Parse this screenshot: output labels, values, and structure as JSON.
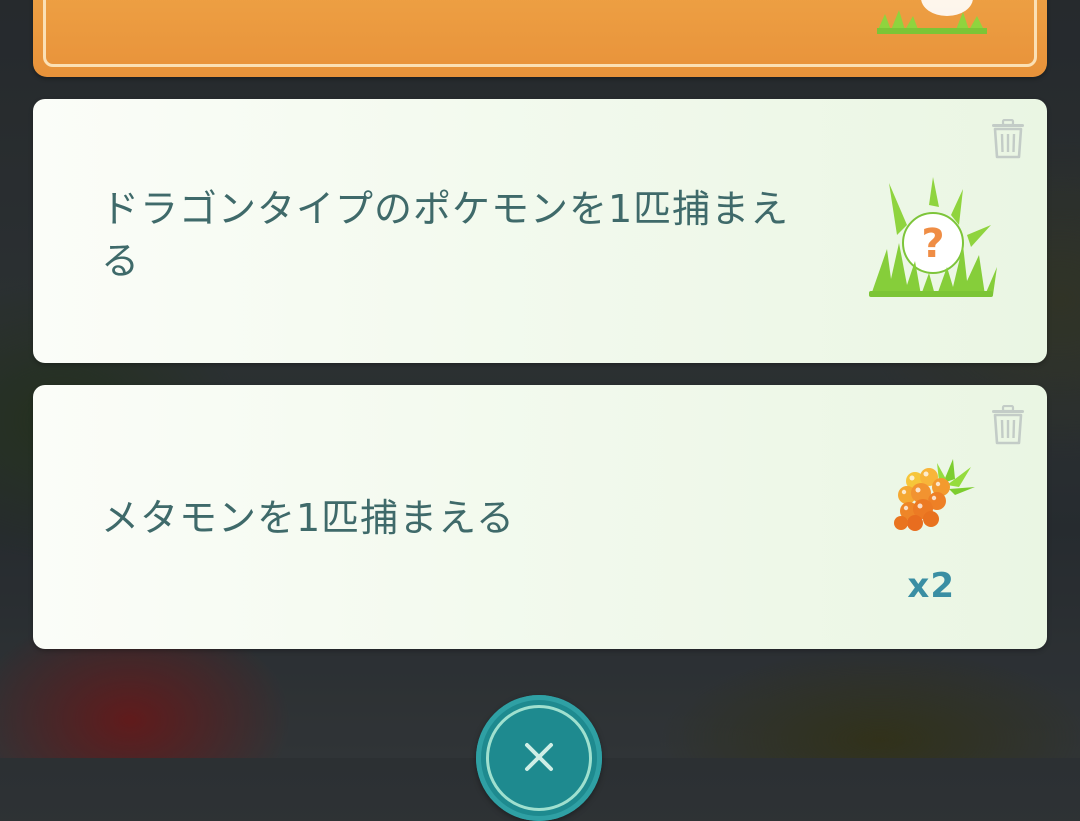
{
  "quests": [
    {
      "text": "ドラゴンタイプのポケモンを1匹捕まえる",
      "reward": {
        "type": "pokemon-encounter",
        "icon": "mystery-pokemon-encounter-icon"
      }
    },
    {
      "text": "メタモンを1匹捕まえる",
      "reward": {
        "type": "item",
        "icon": "golden-razz-berry-icon",
        "count": "x2"
      }
    }
  ],
  "icons": {
    "trash": "trash-icon",
    "close": "close-icon"
  },
  "colors": {
    "quest_text": "#3f6a6a",
    "reward_count": "#3a8ea3",
    "special_card": "#e8923a",
    "close_button": "#1e8a8f",
    "card_background": "#f1f9ec"
  }
}
